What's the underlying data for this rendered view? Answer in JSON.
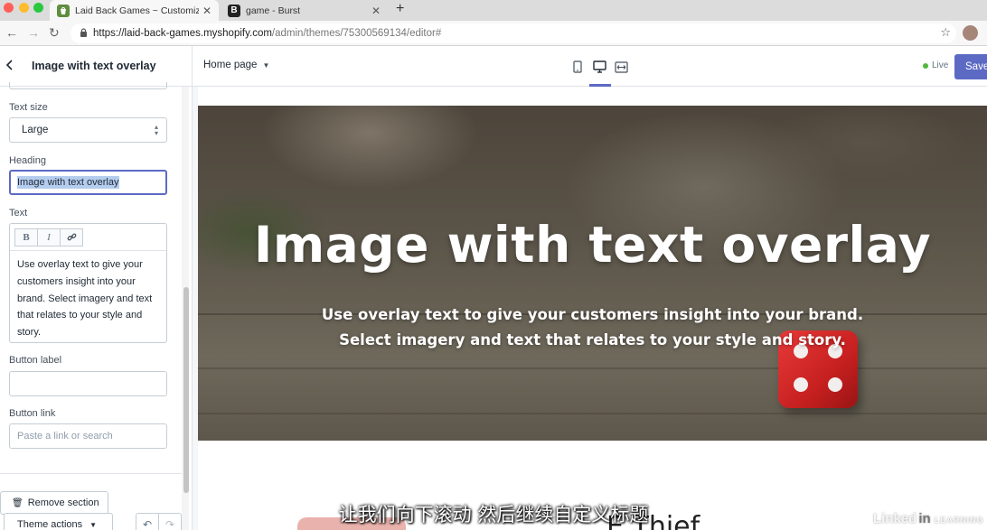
{
  "browser": {
    "tabs": [
      {
        "title": "Laid Back Games ~ Customize",
        "favicon": "shopify-icon",
        "active": true
      },
      {
        "title": "game - Burst",
        "favicon": "burst-icon",
        "active": false
      }
    ],
    "url": {
      "host": "https://laid-back-games.myshopify.com",
      "path": "/admin/themes/75300569134/editor#"
    }
  },
  "sidebar": {
    "title": "Image with text overlay",
    "text_size": {
      "label": "Text size",
      "value": "Large"
    },
    "heading": {
      "label": "Heading",
      "value": "Image with text overlay"
    },
    "text": {
      "label": "Text",
      "toolbar": {
        "bold": "B",
        "italic": "I"
      },
      "value": "Use overlay text to give your customers insight into your brand. Select imagery and text that relates to your style and story."
    },
    "button_label": {
      "label": "Button label",
      "value": ""
    },
    "button_link": {
      "label": "Button link",
      "placeholder": "Paste a link or search"
    },
    "remove_section": "Remove section",
    "theme_actions": "Theme actions"
  },
  "topbar": {
    "page": "Home page",
    "status": "Live",
    "save": "Save",
    "colors": {
      "accent": "#5c6ac4",
      "live": "#50b83c"
    }
  },
  "preview": {
    "hero_heading": "Image with text overlay",
    "hero_text_line1": "Use overlay text to give your customers insight into your brand.",
    "hero_text_line2": "Select imagery and text that relates to your style and story.",
    "below_title": "E Thief"
  },
  "overlay": {
    "subtitle": "让我们向下滚动 然后继续自定义标题",
    "watermark_a": "Linked",
    "watermark_b": "in",
    "watermark_c": "LEARNING"
  }
}
